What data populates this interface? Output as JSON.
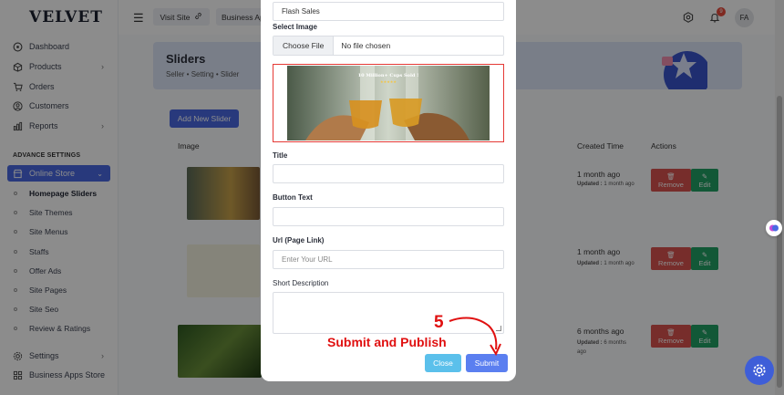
{
  "brand": {
    "logo": "VELVET"
  },
  "sidebar": {
    "items": [
      {
        "label": "Dashboard",
        "icon": "dashboard-icon"
      },
      {
        "label": "Products",
        "icon": "box-icon",
        "chevron": "›"
      },
      {
        "label": "Orders",
        "icon": "cart-icon"
      },
      {
        "label": "Customers",
        "icon": "user-icon"
      },
      {
        "label": "Reports",
        "icon": "chart-icon",
        "chevron": "›"
      }
    ],
    "section_label": "ADVANCE SETTINGS",
    "online_store": {
      "label": "Online Store",
      "chevron": "⌄"
    },
    "sub_items": [
      "Homepage Sliders",
      "Site Themes",
      "Site Menus",
      "Staffs",
      "Offer Ads",
      "Site Pages",
      "Site Seo",
      "Review & Ratings"
    ],
    "bottom_items": [
      {
        "label": "Settings",
        "icon": "gear-icon",
        "chevron": "›"
      },
      {
        "label": "Business Apps Store",
        "icon": "apps-icon"
      }
    ]
  },
  "topbar": {
    "visit_site": "Visit Site",
    "business_apps": "Business Ap",
    "notification_count": "9",
    "avatar_initials": "FA"
  },
  "page": {
    "title": "Sliders",
    "breadcrumb": "Seller  •  Setting  •  Slider",
    "add_button": "Add New Slider",
    "columns": {
      "image": "Image",
      "created": "Created Time",
      "actions": "Actions"
    },
    "rows": [
      {
        "created": "1 month ago",
        "updated_label": "Updated :",
        "updated": "1 month ago"
      },
      {
        "created": "1 month ago",
        "updated_label": "Updated :",
        "updated": "1 month ago"
      },
      {
        "created": "6 months ago",
        "updated_label": "Updated :",
        "updated": "6 months ago"
      }
    ],
    "remove_label": "Remove",
    "edit_label": "Edit"
  },
  "modal": {
    "top_value": "Flash Sales",
    "select_image_label": "Select Image",
    "choose_file": "Choose File",
    "no_file": "No file chosen",
    "preview_caption": "10 Million+ Cups Sold !",
    "title_label": "Title",
    "title_value": "",
    "button_text_label": "Button Text",
    "button_text_value": "",
    "url_label": "Url (Page Link)",
    "url_placeholder": "Enter Your URL",
    "short_desc_label": "Short Description",
    "close_label": "Close",
    "submit_label": "Submit"
  },
  "annotation": {
    "step_number": "5",
    "text": "Submit and Publish"
  },
  "colors": {
    "primary": "#4a69e2",
    "danger": "#d9534f",
    "success": "#22a065",
    "annotation": "#e01010"
  }
}
